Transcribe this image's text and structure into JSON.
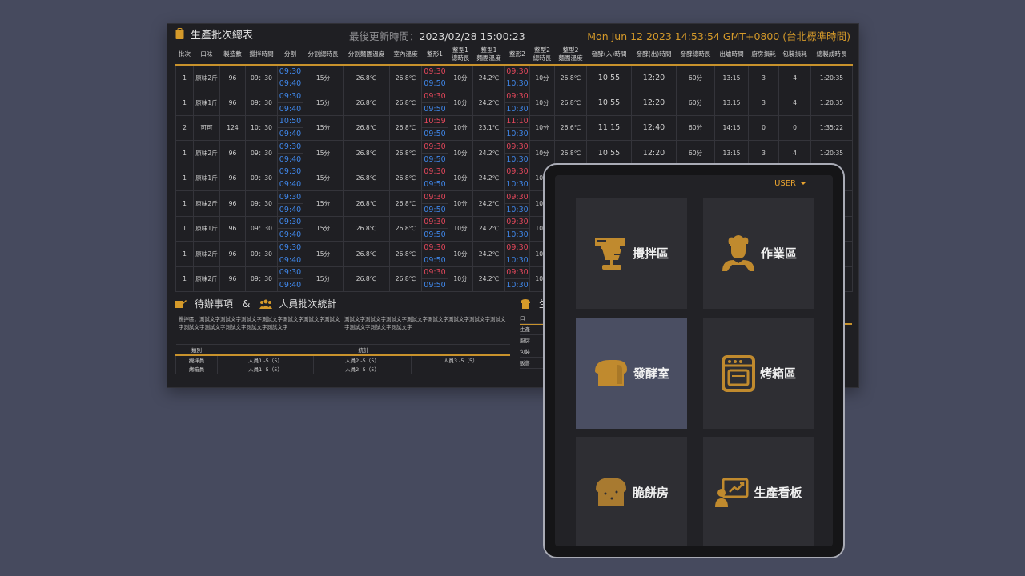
{
  "dashboard": {
    "title": "生產批次總表",
    "update_label": "最後更新時間：",
    "update_value": "2023/02/28 15:00:23",
    "clock": "Mon Jun 12 2023 14:53:54 GMT+0800 (台北標準時間)",
    "columns": [
      "批次",
      "口味",
      "製造數",
      "攪拌時間",
      "分割",
      "分割總時長",
      "分割麵團溫度",
      "室內溫度",
      "整形1",
      "整型1\n總時長",
      "整型1\n麵團溫度",
      "整形2",
      "整型2\n總時長",
      "整型2\n麵團溫度",
      "發酵(入)時間",
      "發酵(出)時間",
      "發酵總時長",
      "出爐時間",
      "廚房損耗",
      "包裝損耗",
      "總製成時長"
    ],
    "rows": [
      {
        "batch": "1",
        "flavor": "原味2斤",
        "qty": "96",
        "mix": "09：30",
        "cut_a": "09:30",
        "cut_b": "09:40",
        "cut_dur": "15分",
        "cut_temp": "26.8℃",
        "room": "26.8℃",
        "s1_a": "09:30",
        "s1_b": "09:50",
        "s1_dur": "10分",
        "s1_temp": "24.2℃",
        "s2_a": "09:30",
        "s2_b": "10:30",
        "s2_dur": "10分",
        "s2_temp": "26.8℃",
        "f_in": "10:55",
        "f_out": "12:20",
        "f_dur": "60分",
        "out": "13:15",
        "k_loss": "3",
        "p_loss": "4",
        "total": "1:20:35"
      },
      {
        "batch": "1",
        "flavor": "原味1斤",
        "qty": "96",
        "mix": "09：30",
        "cut_a": "09:30",
        "cut_b": "09:40",
        "cut_dur": "15分",
        "cut_temp": "26.8℃",
        "room": "26.8℃",
        "s1_a": "09:30",
        "s1_b": "09:50",
        "s1_dur": "10分",
        "s1_temp": "24.2℃",
        "s2_a": "09:30",
        "s2_b": "10:30",
        "s2_dur": "10分",
        "s2_temp": "26.8℃",
        "f_in": "10:55",
        "f_out": "12:20",
        "f_dur": "60分",
        "out": "13:15",
        "k_loss": "3",
        "p_loss": "4",
        "total": "1:20:35"
      },
      {
        "batch": "2",
        "flavor": "可可",
        "qty": "124",
        "mix": "10：30",
        "cut_a": "10:50",
        "cut_b": "09:40",
        "cut_dur": "15分",
        "cut_temp": "26.8℃",
        "room": "26.8℃",
        "s1_a": "10:59",
        "s1_b": "09:50",
        "s1_dur": "10分",
        "s1_temp": "23.1℃",
        "s2_a": "11:10",
        "s2_b": "10:30",
        "s2_dur": "10分",
        "s2_temp": "26.6℃",
        "f_in": "11:15",
        "f_out": "12:40",
        "f_dur": "60分",
        "out": "14:15",
        "k_loss": "0",
        "p_loss": "0",
        "total": "1:35:22"
      },
      {
        "batch": "1",
        "flavor": "原味2斤",
        "qty": "96",
        "mix": "09：30",
        "cut_a": "09:30",
        "cut_b": "09:40",
        "cut_dur": "15分",
        "cut_temp": "26.8℃",
        "room": "26.8℃",
        "s1_a": "09:30",
        "s1_b": "09:50",
        "s1_dur": "10分",
        "s1_temp": "24.2℃",
        "s2_a": "09:30",
        "s2_b": "10:30",
        "s2_dur": "10分",
        "s2_temp": "26.8℃",
        "f_in": "10:55",
        "f_out": "12:20",
        "f_dur": "60分",
        "out": "13:15",
        "k_loss": "3",
        "p_loss": "4",
        "total": "1:20:35"
      },
      {
        "batch": "1",
        "flavor": "原味1斤",
        "qty": "96",
        "mix": "09：30",
        "cut_a": "09:30",
        "cut_b": "09:40",
        "cut_dur": "15分",
        "cut_temp": "26.8℃",
        "room": "26.8℃",
        "s1_a": "09:30",
        "s1_b": "09:50",
        "s1_dur": "10分",
        "s1_temp": "24.2℃",
        "s2_a": "09:30",
        "s2_b": "10:30",
        "s2_dur": "10分",
        "s2_temp": "",
        "f_in": "",
        "f_out": "",
        "f_dur": "",
        "out": "",
        "k_loss": "",
        "p_loss": "",
        "total": ""
      },
      {
        "batch": "1",
        "flavor": "原味2斤",
        "qty": "96",
        "mix": "09：30",
        "cut_a": "09:30",
        "cut_b": "09:40",
        "cut_dur": "15分",
        "cut_temp": "26.8℃",
        "room": "26.8℃",
        "s1_a": "09:30",
        "s1_b": "09:50",
        "s1_dur": "10分",
        "s1_temp": "24.2℃",
        "s2_a": "09:30",
        "s2_b": "10:30",
        "s2_dur": "10分",
        "s2_temp": "",
        "f_in": "",
        "f_out": "",
        "f_dur": "",
        "out": "",
        "k_loss": "",
        "p_loss": "",
        "total": ""
      },
      {
        "batch": "1",
        "flavor": "原味1斤",
        "qty": "96",
        "mix": "09：30",
        "cut_a": "09:30",
        "cut_b": "09:40",
        "cut_dur": "15分",
        "cut_temp": "26.8℃",
        "room": "26.8℃",
        "s1_a": "09:30",
        "s1_b": "09:50",
        "s1_dur": "10分",
        "s1_temp": "24.2℃",
        "s2_a": "09:30",
        "s2_b": "10:30",
        "s2_dur": "10分",
        "s2_temp": "",
        "f_in": "",
        "f_out": "",
        "f_dur": "",
        "out": "",
        "k_loss": "",
        "p_loss": "",
        "total": ""
      },
      {
        "batch": "1",
        "flavor": "原味2斤",
        "qty": "96",
        "mix": "09：30",
        "cut_a": "09:30",
        "cut_b": "09:40",
        "cut_dur": "15分",
        "cut_temp": "26.8℃",
        "room": "26.8℃",
        "s1_a": "09:30",
        "s1_b": "09:50",
        "s1_dur": "10分",
        "s1_temp": "24.2℃",
        "s2_a": "09:30",
        "s2_b": "10:30",
        "s2_dur": "10分",
        "s2_temp": "",
        "f_in": "",
        "f_out": "",
        "f_dur": "",
        "out": "",
        "k_loss": "",
        "p_loss": "",
        "total": ""
      },
      {
        "batch": "1",
        "flavor": "原味2斤",
        "qty": "96",
        "mix": "09：30",
        "cut_a": "09:30",
        "cut_b": "09:40",
        "cut_dur": "15分",
        "cut_temp": "26.8℃",
        "room": "26.8℃",
        "s1_a": "09:30",
        "s1_b": "09:50",
        "s1_dur": "10分",
        "s1_temp": "24.2℃",
        "s2_a": "09:30",
        "s2_b": "10:30",
        "s2_dur": "10分",
        "s2_temp": "",
        "f_in": "",
        "f_out": "",
        "f_dur": "",
        "out": "",
        "k_loss": "",
        "p_loss": "",
        "total": ""
      }
    ],
    "todo_title": "待辦事項",
    "amp": "&",
    "staff_title": "人員批次統計",
    "note_left": "攪拌區：測試文字測試文字測試文字測試文字測試文字測試文字測試文字測試文字測試文字測試文字測試文字測試文字",
    "note_right": "測試文字測試文字測試文字測試文字測試文字測試文字測試文字測試文字測試文字測試文字測試文字",
    "stats_headers": [
      "類別",
      "統計"
    ],
    "stats_rows": [
      {
        "category": "攪拌員",
        "c1": "人員1  -5（5）",
        "c2": "人員2  -5（5）",
        "c3": "人員3  -5（5）"
      },
      {
        "category": "烤箱員",
        "c1": "人員1  -5（5）",
        "c2": "人員2  -5（5）",
        "c3": ""
      }
    ],
    "right_title": "生",
    "right_list": [
      "口",
      "生產",
      "廚房",
      "包裝",
      "販售"
    ]
  },
  "tablet": {
    "user_label": "USER",
    "tiles": [
      {
        "label": "攪拌區",
        "icon": "mixer-icon"
      },
      {
        "label": "作業區",
        "icon": "chef-icon"
      },
      {
        "label": "發酵室",
        "icon": "bread-loaf-icon"
      },
      {
        "label": "烤箱區",
        "icon": "oven-icon"
      },
      {
        "label": "脆餅房",
        "icon": "toast-icon"
      },
      {
        "label": "生產看板",
        "icon": "presentation-board-icon"
      }
    ],
    "colors": {
      "accent": "#e7a22f",
      "icon": "#c08a2e",
      "active_tile": "#4a4e62",
      "tile": "#2e2e33"
    }
  }
}
